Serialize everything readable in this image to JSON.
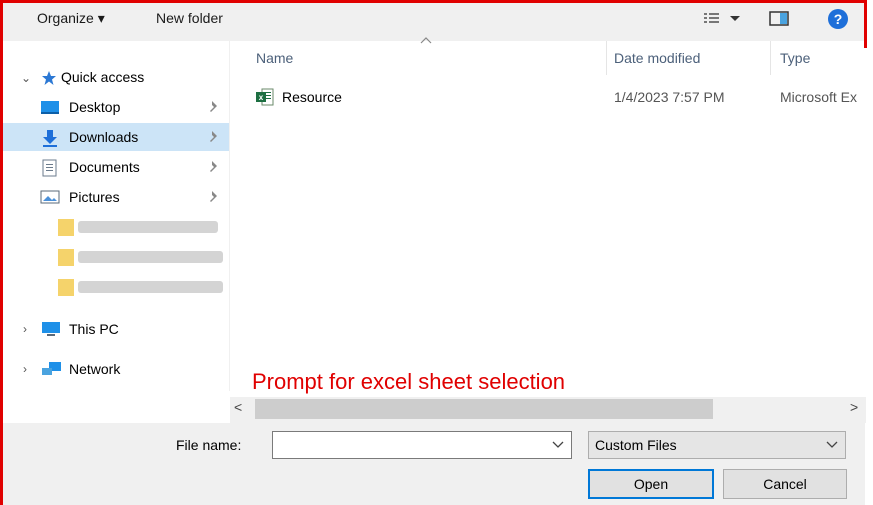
{
  "toolbar": {
    "organize_label": "Organize ▾",
    "new_folder_label": "New folder"
  },
  "nav": {
    "quick_access_label": "Quick access",
    "items": [
      {
        "label": "Desktop"
      },
      {
        "label": "Downloads"
      },
      {
        "label": "Documents"
      },
      {
        "label": "Pictures"
      }
    ],
    "this_pc_label": "This PC",
    "network_label": "Network"
  },
  "columns": {
    "name": "Name",
    "date_modified": "Date modified",
    "type": "Type"
  },
  "files": [
    {
      "name": "Resource",
      "date_modified": "1/4/2023 7:57 PM",
      "type": "Microsoft Ex"
    }
  ],
  "annotation": "Prompt for excel sheet selection",
  "bottom": {
    "file_name_label": "File name:",
    "file_name_value": "",
    "filter_value": "Custom Files",
    "open_label": "Open",
    "cancel_label": "Cancel"
  },
  "colors": {
    "annotation_red": "#e00000",
    "selection_blue": "#cce4f7",
    "accent_blue": "#0078d7"
  }
}
